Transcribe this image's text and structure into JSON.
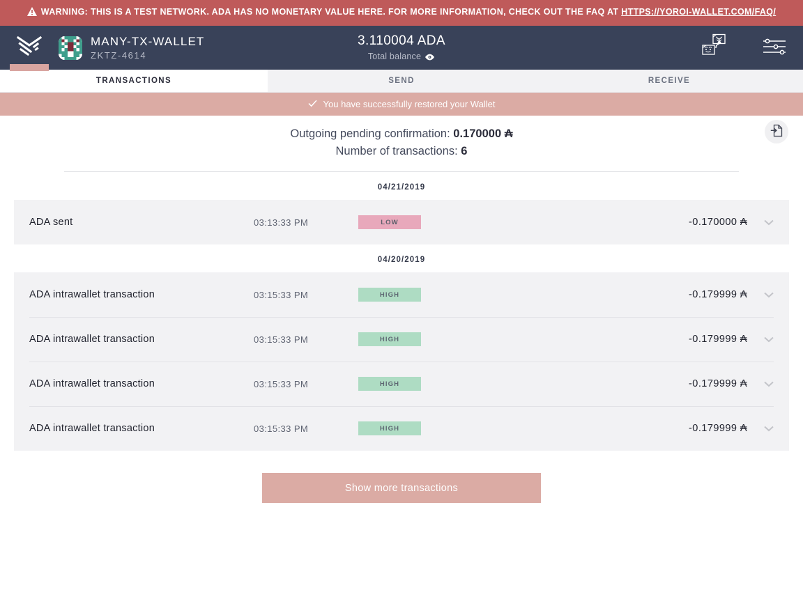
{
  "warning": {
    "icon": "warning-triangle-icon",
    "text": "WARNING: THIS IS A TEST NETWORK. ADA HAS NO MONETARY VALUE HERE. FOR MORE INFORMATION, CHECK OUT THE FAQ AT ",
    "link_text": "HTTPS://YOROI-WALLET.COM/FAQ/",
    "bg_color": "#bf5a5a"
  },
  "header": {
    "logo_icon": "yoroi-logo-icon",
    "avatar_icon": "wallet-identicon",
    "wallet_name": "MANY-TX-WALLET",
    "wallet_plate": "ZKTZ-4614",
    "balance_amount": "3.110004 ADA",
    "balance_label": "Total balance",
    "balance_eye_icon": "eye-icon",
    "wallet_switch_icon": "wallet-switch-icon",
    "settings_icon": "settings-sliders-icon",
    "bg_color": "#394259",
    "accent_color": "#d9a5a0"
  },
  "tabs": [
    {
      "label": "Transactions",
      "active": true
    },
    {
      "label": "Send",
      "active": false
    },
    {
      "label": "Receive",
      "active": false
    }
  ],
  "notification": {
    "icon": "check-icon",
    "text": "You have successfully restored your Wallet",
    "bg_color": "#dbaba4"
  },
  "summary": {
    "export_icon": "export-transactions-icon",
    "pending_label": "Outgoing pending confirmation:",
    "pending_value": "0.170000 ₳",
    "count_label": "Number of transactions:",
    "count_value": "6"
  },
  "groups": [
    {
      "date": "04/21/2019",
      "transactions": [
        {
          "type": "ADA sent",
          "time": "03:13:33 PM",
          "status": "LOW",
          "status_class": "low",
          "amount": "-0.170000 ₳",
          "chevron_icon": "chevron-down-icon"
        }
      ]
    },
    {
      "date": "04/20/2019",
      "transactions": [
        {
          "type": "ADA intrawallet transaction",
          "time": "03:15:33 PM",
          "status": "HIGH",
          "status_class": "high",
          "amount": "-0.179999 ₳",
          "chevron_icon": "chevron-down-icon"
        },
        {
          "type": "ADA intrawallet transaction",
          "time": "03:15:33 PM",
          "status": "HIGH",
          "status_class": "high",
          "amount": "-0.179999 ₳",
          "chevron_icon": "chevron-down-icon"
        },
        {
          "type": "ADA intrawallet transaction",
          "time": "03:15:33 PM",
          "status": "HIGH",
          "status_class": "high",
          "amount": "-0.179999 ₳",
          "chevron_icon": "chevron-down-icon"
        },
        {
          "type": "ADA intrawallet transaction",
          "time": "03:15:33 PM",
          "status": "HIGH",
          "status_class": "high",
          "amount": "-0.179999 ₳",
          "chevron_icon": "chevron-down-icon"
        }
      ]
    }
  ],
  "footer": {
    "show_more_label": "Show more transactions"
  },
  "colors": {
    "badge_low": "#e8a8bb",
    "badge_high": "#aedcc3",
    "row_bg": "#f2f2f4",
    "accent": "#dbaba4"
  }
}
